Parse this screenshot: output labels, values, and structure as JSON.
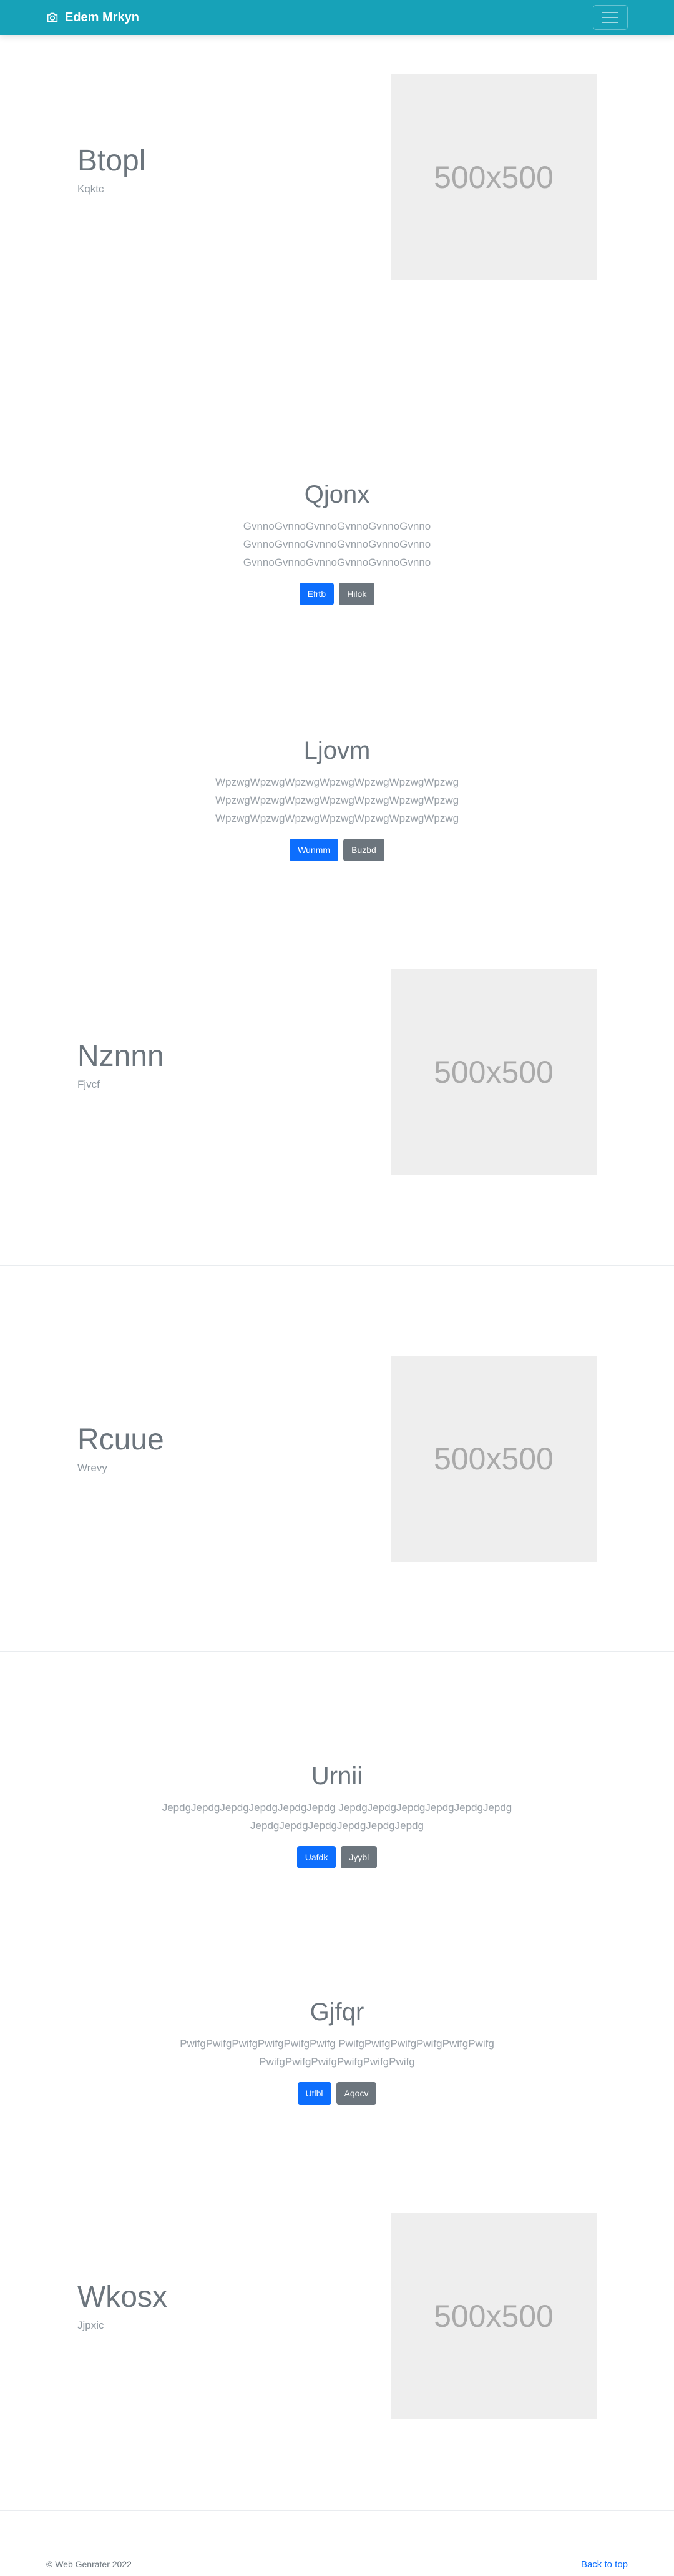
{
  "navbar": {
    "brand": "Edem Mrkyn",
    "brand_icon": "camera-icon",
    "toggler_icon": "hamburger-menu-icon"
  },
  "placeholder_label": "500x500",
  "features": [
    {
      "title": "Btopl",
      "subtitle": "Kqktc"
    },
    {
      "title": "Nznnn",
      "subtitle": "Fjvcf"
    },
    {
      "title": "Rcuue",
      "subtitle": "Wrevy"
    },
    {
      "title": "Wkosx",
      "subtitle": "Jjpxic"
    }
  ],
  "jumbotrons": [
    {
      "title": "Qjonx",
      "lines": [
        "GvnnoGvnnoGvnnoGvnnoGvnnoGvnno",
        "GvnnoGvnnoGvnnoGvnnoGvnnoGvnno",
        "GvnnoGvnnoGvnnoGvnnoGvnnoGvnno"
      ],
      "primary": "Efrtb",
      "secondary": "Hilok"
    },
    {
      "title": "Ljovm",
      "lines": [
        "WpzwgWpzwgWpzwgWpzwgWpzwgWpzwgWpzwg",
        "WpzwgWpzwgWpzwgWpzwgWpzwgWpzwgWpzwg",
        "WpzwgWpzwgWpzwgWpzwgWpzwgWpzwgWpzwg"
      ],
      "primary": "Wunmm",
      "secondary": "Buzbd"
    },
    {
      "title": "Urnii",
      "lines": [
        "JepdgJepdgJepdgJepdgJepdgJepdg JepdgJepdgJepdgJepdgJepdgJepdg",
        "JepdgJepdgJepdgJepdgJepdgJepdg"
      ],
      "primary": "Uafdk",
      "secondary": "Jyybl"
    },
    {
      "title": "Gjfqr",
      "lines": [
        "PwifgPwifgPwifgPwifgPwifgPwifg PwifgPwifgPwifgPwifgPwifgPwifg",
        "PwifgPwifgPwifgPwifgPwifgPwifg"
      ],
      "primary": "Utlbl",
      "secondary": "Aqocv"
    }
  ],
  "footer": {
    "copyright": "© Web Genrater 2022",
    "back_to_top": "Back to top"
  }
}
